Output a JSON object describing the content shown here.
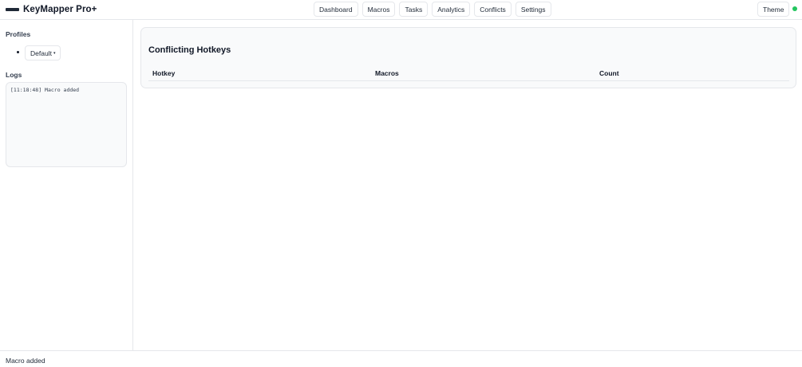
{
  "app": {
    "title": "KeyMapper Pro+"
  },
  "nav": {
    "items": [
      {
        "label": "Dashboard"
      },
      {
        "label": "Macros"
      },
      {
        "label": "Tasks"
      },
      {
        "label": "Analytics"
      },
      {
        "label": "Conflicts"
      },
      {
        "label": "Settings"
      }
    ]
  },
  "header": {
    "theme_label": "Theme",
    "status_color": "#22c55e"
  },
  "sidebar": {
    "profiles_title": "Profiles",
    "profiles": [
      {
        "label": "Default",
        "caret": "▾"
      }
    ],
    "logs_title": "Logs",
    "logs": [
      "[11:18:48] Macro added"
    ]
  },
  "main": {
    "card_title": "Conflicting Hotkeys",
    "columns": [
      "Hotkey",
      "Macros",
      "Count"
    ],
    "rows": []
  },
  "footer": {
    "status_text": "Macro added"
  },
  "icons": {
    "logo": "keyboard-icon",
    "status": "status-dot-icon"
  }
}
